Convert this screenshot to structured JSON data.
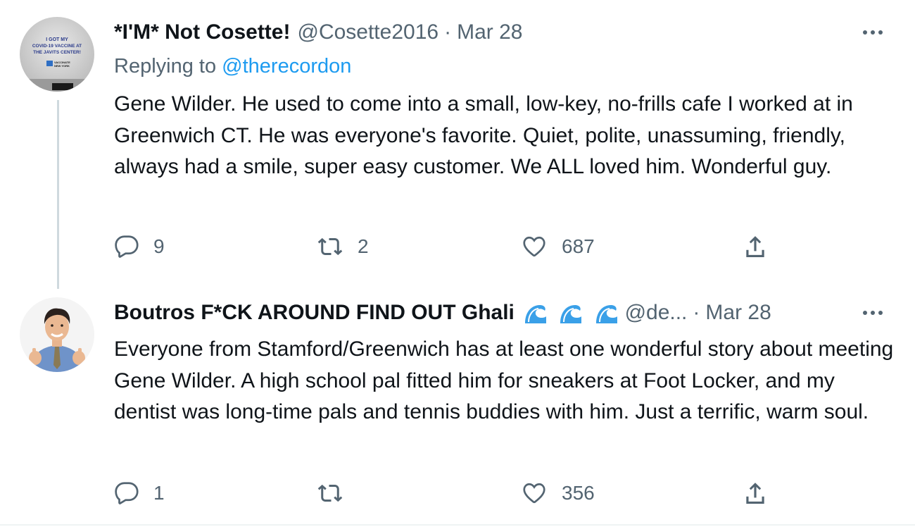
{
  "tweets": [
    {
      "author_name": "*I'M* Not Cosette!",
      "handle": "@Cosette2016",
      "separator": "·",
      "date": "Mar 28",
      "replying_prefix": "Replying to",
      "replying_to": "@therecordon",
      "avatar_text": [
        "I GOT MY",
        "COVID-19 VACCINE AT",
        "THE JAVITS CENTER!",
        "VACCINATE",
        "NEW YORK"
      ],
      "text": "Gene Wilder. He used to come into a small, low-key, no-frills cafe I worked at in Greenwich CT. He was everyone's favorite. Quiet, polite, unassuming, friendly, always had a smile, super easy customer. We ALL loved him. Wonderful guy.",
      "replies": "9",
      "retweets": "2",
      "likes": "687"
    },
    {
      "author_name": "Boutros F*CK AROUND FIND OUT Ghali",
      "handle": "@de...",
      "separator": "·",
      "date": "Mar 28",
      "name_emojis": [
        "water-wave-emoji",
        "water-wave-emoji",
        "water-wave-emoji"
      ],
      "text": "Everyone from Stamford/Greenwich has at least one wonderful story about meeting Gene Wilder. A high school pal fitted him for sneakers at Foot Locker, and my dentist was long-time pals and tennis buddies with him. Just a terrific, warm soul.",
      "replies": "1",
      "retweets": "",
      "likes": "356"
    }
  ],
  "icons": {
    "reply": "reply-icon",
    "retweet": "retweet-icon",
    "like": "heart-icon",
    "share": "share-icon",
    "more": "more-icon"
  },
  "colors": {
    "text_primary": "#0f1419",
    "text_secondary": "#536471",
    "link": "#1d9bf0",
    "thread_line": "#cfd9de",
    "wave_emoji": "#3aa0e8"
  }
}
